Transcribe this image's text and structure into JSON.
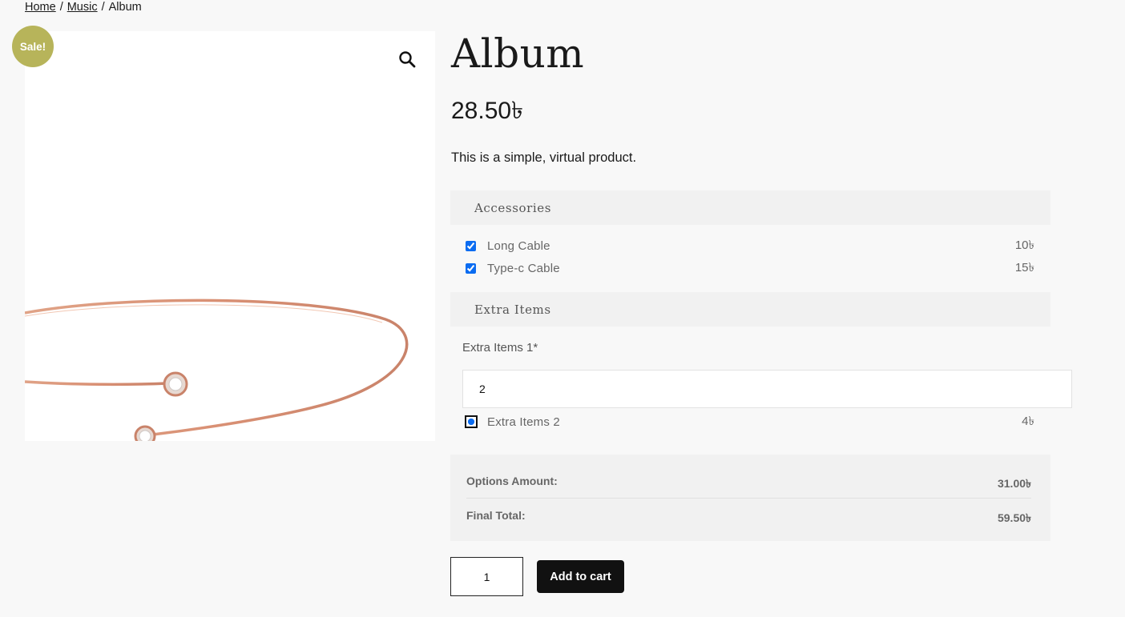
{
  "breadcrumb": {
    "home": "Home",
    "category": "Music",
    "current": "Album",
    "separator": "/"
  },
  "product": {
    "sale_badge": "Sale!",
    "title": "Album",
    "price": "28.50৳",
    "description": "This is a simple, virtual product.",
    "image_icon": "zoom-search-icon"
  },
  "sections": {
    "accessories": {
      "heading": "Accessories",
      "options": [
        {
          "label": "Long Cable",
          "price": "10৳",
          "checked": true
        },
        {
          "label": "Type-c Cable",
          "price": "15৳",
          "checked": true
        }
      ]
    },
    "extra": {
      "heading": "Extra Items",
      "field_label": "Extra Items 1*",
      "field_value": "2",
      "radio": {
        "label": "Extra Items 2",
        "price": "4৳",
        "selected": true
      }
    }
  },
  "totals": {
    "options_label": "Options Amount:",
    "options_value": "31.00৳",
    "final_label": "Final Total:",
    "final_value": "59.50৳"
  },
  "cart": {
    "quantity": "1",
    "button_label": "Add to cart"
  },
  "colors": {
    "sale": "#b7b45a",
    "accent": "#0b6cf1",
    "button": "#111111",
    "panel": "#f1f1f1"
  }
}
